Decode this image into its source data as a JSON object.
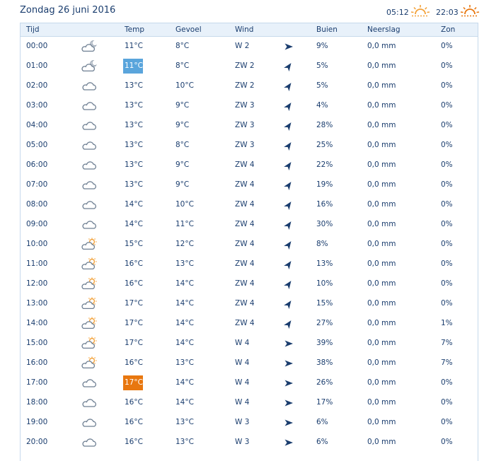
{
  "header": {
    "date": "Zondag 26 juni 2016",
    "sunrise": "05:12",
    "sunset": "22:03",
    "sun_color": "#f3a23a",
    "sunset_color": "#e8770f"
  },
  "columns": [
    "Tijd",
    "",
    "Temp",
    "Gevoel",
    "Wind",
    "",
    "Buien",
    "Neerslag",
    "Zon"
  ],
  "rows": [
    {
      "time": "00:00",
      "icon": "cloud-moon-icon",
      "temp": "11°C",
      "feel": "8°C",
      "wind": "W 2",
      "dir": "east-arrow-icon",
      "rot": 0,
      "showers": "9%",
      "precip": "0,0 mm",
      "sun": "0%",
      "hl": ""
    },
    {
      "time": "01:00",
      "icon": "cloud-moon-icon",
      "temp": "11°C",
      "feel": "8°C",
      "wind": "ZW 2",
      "dir": "northeast-arrow-icon",
      "rot": -55,
      "showers": "5%",
      "precip": "0,0 mm",
      "sun": "0%",
      "hl": "cold"
    },
    {
      "time": "02:00",
      "icon": "cloud-icon",
      "temp": "13°C",
      "feel": "10°C",
      "wind": "ZW 2",
      "dir": "northeast-arrow-icon",
      "rot": -55,
      "showers": "5%",
      "precip": "0,0 mm",
      "sun": "0%",
      "hl": ""
    },
    {
      "time": "03:00",
      "icon": "cloud-icon",
      "temp": "13°C",
      "feel": "9°C",
      "wind": "ZW 3",
      "dir": "northeast-arrow-icon",
      "rot": -55,
      "showers": "4%",
      "precip": "0,0 mm",
      "sun": "0%",
      "hl": ""
    },
    {
      "time": "04:00",
      "icon": "cloud-icon",
      "temp": "13°C",
      "feel": "9°C",
      "wind": "ZW 3",
      "dir": "northeast-arrow-icon",
      "rot": -55,
      "showers": "28%",
      "precip": "0,0 mm",
      "sun": "0%",
      "hl": ""
    },
    {
      "time": "05:00",
      "icon": "cloud-icon",
      "temp": "13°C",
      "feel": "8°C",
      "wind": "ZW 3",
      "dir": "northeast-arrow-icon",
      "rot": -55,
      "showers": "25%",
      "precip": "0,0 mm",
      "sun": "0%",
      "hl": ""
    },
    {
      "time": "06:00",
      "icon": "cloud-icon",
      "temp": "13°C",
      "feel": "9°C",
      "wind": "ZW 4",
      "dir": "northeast-arrow-icon",
      "rot": -55,
      "showers": "22%",
      "precip": "0,0 mm",
      "sun": "0%",
      "hl": ""
    },
    {
      "time": "07:00",
      "icon": "cloud-icon",
      "temp": "13°C",
      "feel": "9°C",
      "wind": "ZW 4",
      "dir": "northeast-arrow-icon",
      "rot": -55,
      "showers": "19%",
      "precip": "0,0 mm",
      "sun": "0%",
      "hl": ""
    },
    {
      "time": "08:00",
      "icon": "cloud-icon",
      "temp": "14°C",
      "feel": "10°C",
      "wind": "ZW 4",
      "dir": "northeast-arrow-icon",
      "rot": -55,
      "showers": "16%",
      "precip": "0,0 mm",
      "sun": "0%",
      "hl": ""
    },
    {
      "time": "09:00",
      "icon": "cloud-icon",
      "temp": "14°C",
      "feel": "11°C",
      "wind": "ZW 4",
      "dir": "northeast-arrow-icon",
      "rot": -55,
      "showers": "30%",
      "precip": "0,0 mm",
      "sun": "0%",
      "hl": ""
    },
    {
      "time": "10:00",
      "icon": "cloud-sun-icon",
      "temp": "15°C",
      "feel": "12°C",
      "wind": "ZW 4",
      "dir": "northeast-arrow-icon",
      "rot": -55,
      "showers": "8%",
      "precip": "0,0 mm",
      "sun": "0%",
      "hl": ""
    },
    {
      "time": "11:00",
      "icon": "cloud-sun-icon",
      "temp": "16°C",
      "feel": "13°C",
      "wind": "ZW 4",
      "dir": "northeast-arrow-icon",
      "rot": -55,
      "showers": "13%",
      "precip": "0,0 mm",
      "sun": "0%",
      "hl": ""
    },
    {
      "time": "12:00",
      "icon": "cloud-sun-icon",
      "temp": "16°C",
      "feel": "14°C",
      "wind": "ZW 4",
      "dir": "northeast-arrow-icon",
      "rot": -55,
      "showers": "10%",
      "precip": "0,0 mm",
      "sun": "0%",
      "hl": ""
    },
    {
      "time": "13:00",
      "icon": "cloud-sun-icon",
      "temp": "17°C",
      "feel": "14°C",
      "wind": "ZW 4",
      "dir": "northeast-arrow-icon",
      "rot": -55,
      "showers": "15%",
      "precip": "0,0 mm",
      "sun": "0%",
      "hl": ""
    },
    {
      "time": "14:00",
      "icon": "cloud-sun-icon",
      "temp": "17°C",
      "feel": "14°C",
      "wind": "ZW 4",
      "dir": "northeast-arrow-icon",
      "rot": -55,
      "showers": "27%",
      "precip": "0,0 mm",
      "sun": "1%",
      "hl": ""
    },
    {
      "time": "15:00",
      "icon": "cloud-sun-icon",
      "temp": "17°C",
      "feel": "14°C",
      "wind": "W 4",
      "dir": "east-arrow-icon",
      "rot": 0,
      "showers": "39%",
      "precip": "0,0 mm",
      "sun": "7%",
      "hl": ""
    },
    {
      "time": "16:00",
      "icon": "cloud-sun-icon",
      "temp": "16°C",
      "feel": "13°C",
      "wind": "W 4",
      "dir": "east-arrow-icon",
      "rot": 0,
      "showers": "38%",
      "precip": "0,0 mm",
      "sun": "7%",
      "hl": ""
    },
    {
      "time": "17:00",
      "icon": "cloud-icon",
      "temp": "17°C",
      "feel": "14°C",
      "wind": "W 4",
      "dir": "east-arrow-icon",
      "rot": 0,
      "showers": "26%",
      "precip": "0,0 mm",
      "sun": "0%",
      "hl": "warm"
    },
    {
      "time": "18:00",
      "icon": "cloud-icon",
      "temp": "16°C",
      "feel": "14°C",
      "wind": "W 4",
      "dir": "east-arrow-icon",
      "rot": 0,
      "showers": "17%",
      "precip": "0,0 mm",
      "sun": "0%",
      "hl": ""
    },
    {
      "time": "19:00",
      "icon": "cloud-icon",
      "temp": "16°C",
      "feel": "13°C",
      "wind": "W 3",
      "dir": "east-arrow-icon",
      "rot": 0,
      "showers": "6%",
      "precip": "0,0 mm",
      "sun": "0%",
      "hl": ""
    },
    {
      "time": "20:00",
      "icon": "cloud-icon",
      "temp": "16°C",
      "feel": "13°C",
      "wind": "W 3",
      "dir": "east-arrow-icon",
      "rot": 0,
      "showers": "6%",
      "precip": "0,0 mm",
      "sun": "0%",
      "hl": ""
    }
  ]
}
